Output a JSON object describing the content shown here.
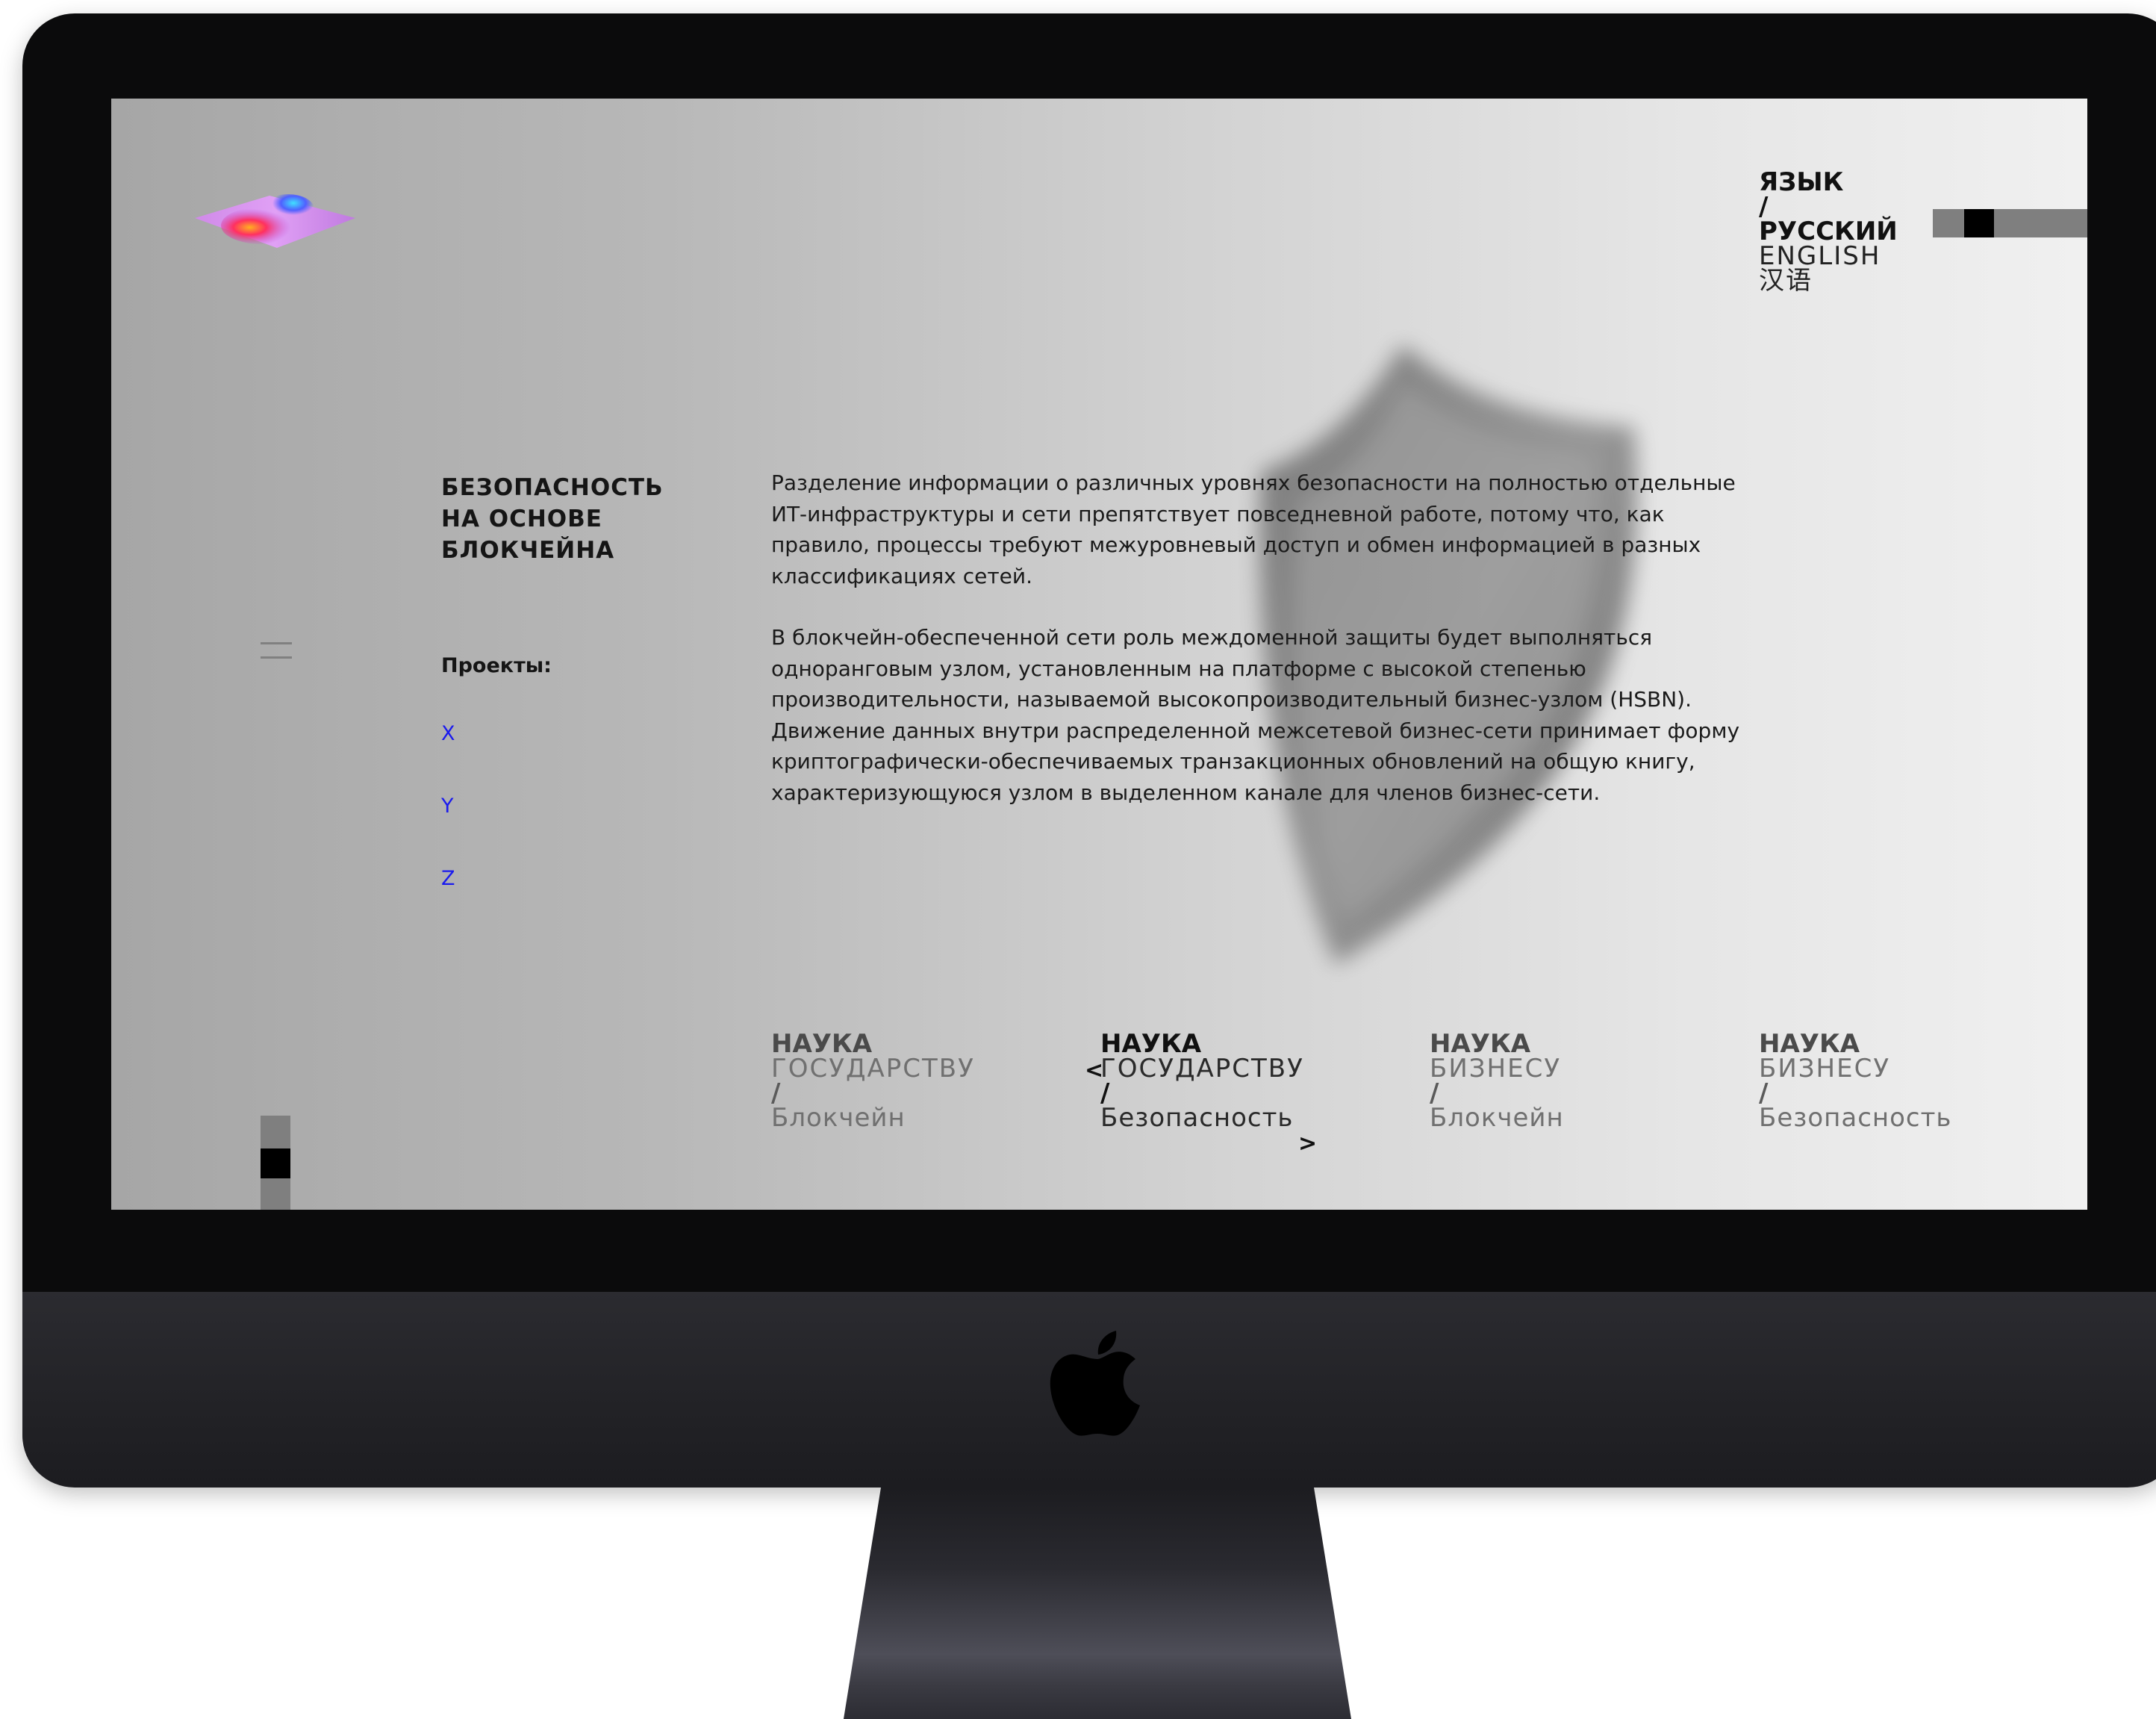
{
  "language": {
    "label": "ЯЗЫК",
    "separator": "/",
    "active": "РУССКИЙ",
    "options": [
      "ENGLISH",
      "汉语"
    ]
  },
  "section": {
    "title_lines": [
      "БЕЗОПАСНОСТЬ",
      "НА ОСНОВЕ",
      "БЛОКЧЕЙНА"
    ],
    "projects_label": "Проекты:",
    "projects": [
      "X",
      "Y",
      "Z"
    ]
  },
  "content": {
    "paragraphs": [
      "Разделение информации о различных уровнях безопасности на полностью отдельные ИТ-инфраструктуры и сети препятствует повседневной работе, потому что, как правило, процессы требуют межуровневый доступ и обмен информацией в разных классификациях сетей.",
      "В блокчейн-обеспеченной сети роль междоменной защиты будет выполняться одноранговым узлом, установленным на платформе с высокой степенью производительности, называемой высокопроизводительный бизнес-узлом (HSBN). Движение данных внутри распределенной межсетевой бизнес-сети принимает форму криптографически-обеспечиваемых транзакционных обновлений на общую книгу, характеризующуюся узлом в выделенном канале для членов бизнес-сети."
    ]
  },
  "nav": {
    "prev_arrow": "<",
    "next_arrow": ">",
    "cards": [
      {
        "head": "НАУКА",
        "sub": "ГОСУДАРСТВУ",
        "sep": "/",
        "topic": "Блокчейн",
        "active": false
      },
      {
        "head": "НАУКА",
        "sub": "ГОСУДАРСТВУ",
        "sep": "/",
        "topic": "Безопасность",
        "active": true
      },
      {
        "head": "НАУКА",
        "sub": "БИЗНЕСУ",
        "sep": "/",
        "topic": "Блокчейн",
        "active": false
      },
      {
        "head": "НАУКА",
        "sub": "БИЗНЕСУ",
        "sep": "/",
        "topic": "Безопасность",
        "active": false
      }
    ]
  },
  "icons": {
    "brand": "holographic-diamond-logo",
    "menu": "menu-icon",
    "device": "apple-logo",
    "background": "shield-image"
  },
  "colors": {
    "link": "#1a1aee",
    "bezel": "#0b0b0c",
    "chin": "#2b2b30"
  }
}
